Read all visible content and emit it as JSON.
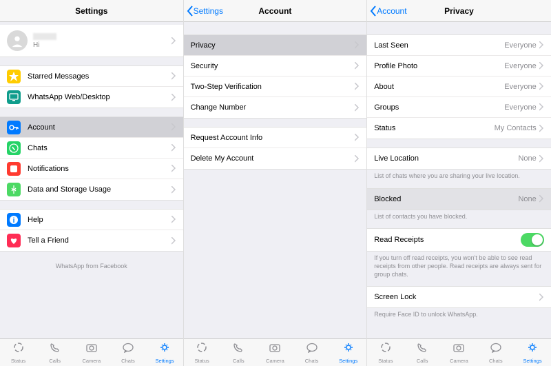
{
  "colors": {
    "accent": "#007aff",
    "star": "#ffcc00",
    "teal": "#4cd3c2",
    "blue": "#007aff",
    "green": "#4cd964",
    "red": "#ff3b30",
    "heart": "#ff2d55",
    "gray": "#8e8e93"
  },
  "screen1": {
    "title": "Settings",
    "profile": {
      "sub": "Hi"
    },
    "group1": [
      {
        "icon": "star-icon",
        "color": "#ffcc00",
        "label": "Starred Messages"
      },
      {
        "icon": "desktop-icon",
        "color": "#16a085",
        "label": "WhatsApp Web/Desktop"
      }
    ],
    "group2": [
      {
        "icon": "key-icon",
        "color": "#007aff",
        "label": "Account",
        "selected": true
      },
      {
        "icon": "whatsapp-icon",
        "color": "#25d366",
        "label": "Chats"
      },
      {
        "icon": "bell-icon",
        "color": "#ff3b30",
        "label": "Notifications"
      },
      {
        "icon": "data-icon",
        "color": "#4cd964",
        "label": "Data and Storage Usage"
      }
    ],
    "group3": [
      {
        "icon": "info-icon",
        "color": "#007aff",
        "label": "Help"
      },
      {
        "icon": "heart-icon",
        "color": "#ff2d55",
        "label": "Tell a Friend"
      }
    ],
    "footer": "WhatsApp from Facebook"
  },
  "screen2": {
    "back": "Settings",
    "title": "Account",
    "group1": [
      {
        "label": "Privacy",
        "selected": true
      },
      {
        "label": "Security"
      },
      {
        "label": "Two-Step Verification"
      },
      {
        "label": "Change Number"
      }
    ],
    "group2": [
      {
        "label": "Request Account Info"
      },
      {
        "label": "Delete My Account"
      }
    ]
  },
  "screen3": {
    "back": "Account",
    "title": "Privacy",
    "group1": [
      {
        "label": "Last Seen",
        "value": "Everyone"
      },
      {
        "label": "Profile Photo",
        "value": "Everyone"
      },
      {
        "label": "About",
        "value": "Everyone"
      },
      {
        "label": "Groups",
        "value": "Everyone"
      },
      {
        "label": "Status",
        "value": "My Contacts"
      }
    ],
    "live": {
      "label": "Live Location",
      "value": "None"
    },
    "live_footer": "List of chats where you are sharing your live location.",
    "blocked": {
      "label": "Blocked",
      "value": "None"
    },
    "blocked_footer": "List of contacts you have blocked.",
    "receipts": {
      "label": "Read Receipts"
    },
    "receipts_footer": "If you turn off read receipts, you won't be able to see read receipts from other people. Read receipts are always sent for group chats.",
    "screenlock": {
      "label": "Screen Lock"
    },
    "screenlock_footer": "Require Face ID to unlock WhatsApp."
  },
  "tabbar": {
    "items": [
      {
        "icon": "status-tab-icon",
        "label": "Status"
      },
      {
        "icon": "calls-tab-icon",
        "label": "Calls"
      },
      {
        "icon": "camera-tab-icon",
        "label": "Camera"
      },
      {
        "icon": "chats-tab-icon",
        "label": "Chats"
      },
      {
        "icon": "settings-tab-icon",
        "label": "Settings",
        "active": true
      }
    ]
  }
}
